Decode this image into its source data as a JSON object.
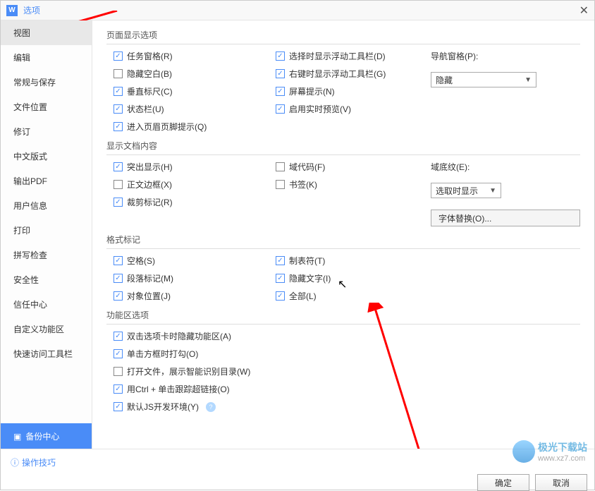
{
  "window": {
    "title": "选项"
  },
  "sidebar": {
    "items": [
      "视图",
      "编辑",
      "常规与保存",
      "文件位置",
      "修订",
      "中文版式",
      "输出PDF",
      "用户信息",
      "打印",
      "拼写检查",
      "安全性",
      "信任中心",
      "自定义功能区",
      "快速访问工具栏"
    ],
    "backup": "备份中心"
  },
  "groups": {
    "page": {
      "title": "页面显示选项",
      "col1": [
        {
          "label": "任务窗格(R)",
          "checked": true
        },
        {
          "label": "隐藏空白(B)",
          "checked": false
        },
        {
          "label": "垂直标尺(C)",
          "checked": true
        },
        {
          "label": "状态栏(U)",
          "checked": true
        },
        {
          "label": "进入页眉页脚提示(Q)",
          "checked": true
        }
      ],
      "col2": [
        {
          "label": "选择时显示浮动工具栏(D)",
          "checked": true
        },
        {
          "label": "右键时显示浮动工具栏(G)",
          "checked": true
        },
        {
          "label": "屏幕提示(N)",
          "checked": true
        },
        {
          "label": "启用实时预览(V)",
          "checked": true
        }
      ],
      "nav_label": "导航窗格(P):",
      "nav_value": "隐藏"
    },
    "doc": {
      "title": "显示文档内容",
      "col1": [
        {
          "label": "突出显示(H)",
          "checked": true
        },
        {
          "label": "正文边框(X)",
          "checked": false
        },
        {
          "label": "裁剪标记(R)",
          "checked": true
        }
      ],
      "col2": [
        {
          "label": "域代码(F)",
          "checked": false
        },
        {
          "label": "书签(K)",
          "checked": false
        }
      ],
      "shade_label": "域底纹(E):",
      "shade_value": "选取时显示",
      "font_btn": "字体替换(O)..."
    },
    "marks": {
      "title": "格式标记",
      "col1": [
        {
          "label": "空格(S)",
          "checked": true
        },
        {
          "label": "段落标记(M)",
          "checked": true
        },
        {
          "label": "对象位置(J)",
          "checked": true
        }
      ],
      "col2": [
        {
          "label": "制表符(T)",
          "checked": true
        },
        {
          "label": "隐藏文字(I)",
          "checked": true
        },
        {
          "label": "全部(L)",
          "checked": true
        }
      ]
    },
    "ribbon": {
      "title": "功能区选项",
      "items": [
        {
          "label": "双击选项卡时隐藏功能区(A)",
          "checked": true
        },
        {
          "label": "单击方框时打勾(O)",
          "checked": true
        },
        {
          "label": "打开文件，展示智能识别目录(W)",
          "checked": false
        },
        {
          "label": "用Ctrl + 单击跟踪超链接(O)",
          "checked": true
        },
        {
          "label": "默认JS开发环境(Y)",
          "checked": true,
          "help": true
        }
      ]
    }
  },
  "footer": {
    "tips": "操作技巧",
    "ok": "确定",
    "cancel": "取消"
  },
  "watermark": {
    "line1": "极光下载站",
    "line2": "www.xz7.com"
  }
}
